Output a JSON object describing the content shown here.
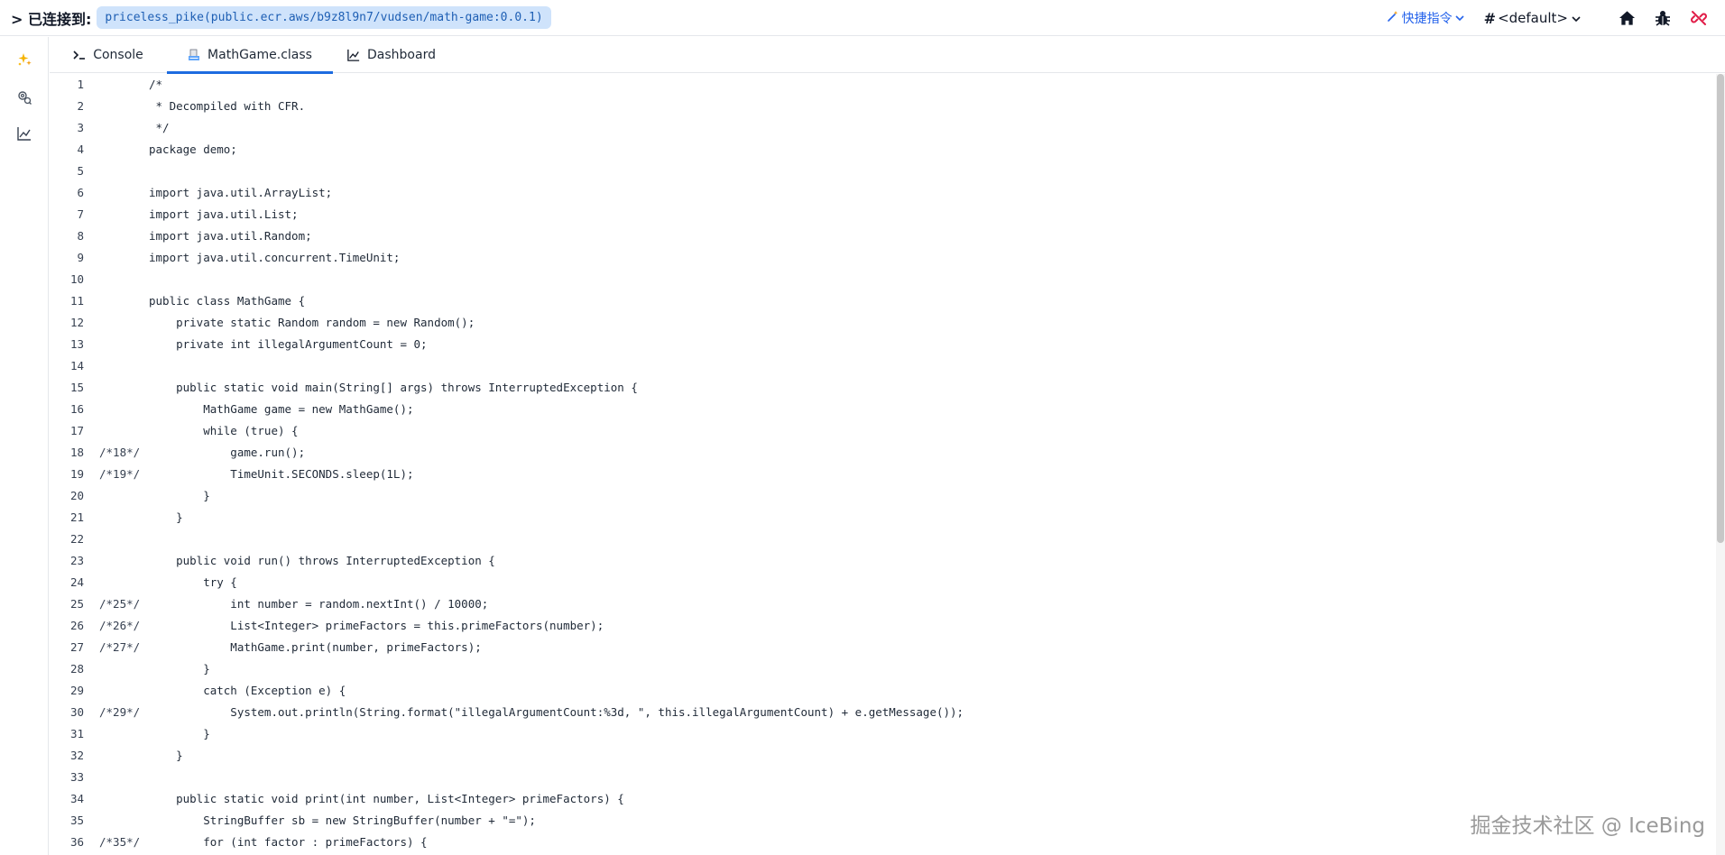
{
  "header": {
    "connected_label": "> 已连接到:",
    "connection": "priceless_pike(public.ecr.aws/b9z8l9n7/vudsen/math-game:0.0.1)",
    "quick_command": "快捷指令",
    "namespace": "<default>",
    "icons": [
      "home-icon",
      "bug-icon",
      "unlink-icon"
    ],
    "accent_color": "#2563eb",
    "danger_color": "#e11d48"
  },
  "sidebar": {
    "icons": [
      "sparkle-icon",
      "settings-search-icon",
      "chart-line-icon"
    ]
  },
  "tabs": [
    {
      "label": "Console",
      "icon": "terminal-icon",
      "active": false
    },
    {
      "label": "MathGame.class",
      "icon": "class-file-icon",
      "active": true
    },
    {
      "label": "Dashboard",
      "icon": "chart-line-icon",
      "active": false
    }
  ],
  "code": {
    "lines": [
      {
        "n": "1",
        "src": "",
        "text": "/*"
      },
      {
        "n": "2",
        "src": "",
        "text": " * Decompiled with CFR."
      },
      {
        "n": "3",
        "src": "",
        "text": " */"
      },
      {
        "n": "4",
        "src": "",
        "text": "package demo;"
      },
      {
        "n": "5",
        "src": "",
        "text": ""
      },
      {
        "n": "6",
        "src": "",
        "text": "import java.util.ArrayList;"
      },
      {
        "n": "7",
        "src": "",
        "text": "import java.util.List;"
      },
      {
        "n": "8",
        "src": "",
        "text": "import java.util.Random;"
      },
      {
        "n": "9",
        "src": "",
        "text": "import java.util.concurrent.TimeUnit;"
      },
      {
        "n": "10",
        "src": "",
        "text": ""
      },
      {
        "n": "11",
        "src": "",
        "text": "public class MathGame {"
      },
      {
        "n": "12",
        "src": "",
        "text": "    private static Random random = new Random();"
      },
      {
        "n": "13",
        "src": "",
        "text": "    private int illegalArgumentCount = 0;"
      },
      {
        "n": "14",
        "src": "",
        "text": ""
      },
      {
        "n": "15",
        "src": "",
        "text": "    public static void main(String[] args) throws InterruptedException {"
      },
      {
        "n": "16",
        "src": "",
        "text": "        MathGame game = new MathGame();"
      },
      {
        "n": "17",
        "src": "",
        "text": "        while (true) {"
      },
      {
        "n": "18",
        "src": "/*18*/",
        "text": "            game.run();"
      },
      {
        "n": "19",
        "src": "/*19*/",
        "text": "            TimeUnit.SECONDS.sleep(1L);"
      },
      {
        "n": "20",
        "src": "",
        "text": "        }"
      },
      {
        "n": "21",
        "src": "",
        "text": "    }"
      },
      {
        "n": "22",
        "src": "",
        "text": ""
      },
      {
        "n": "23",
        "src": "",
        "text": "    public void run() throws InterruptedException {"
      },
      {
        "n": "24",
        "src": "",
        "text": "        try {"
      },
      {
        "n": "25",
        "src": "/*25*/",
        "text": "            int number = random.nextInt() / 10000;"
      },
      {
        "n": "26",
        "src": "/*26*/",
        "text": "            List<Integer> primeFactors = this.primeFactors(number);"
      },
      {
        "n": "27",
        "src": "/*27*/",
        "text": "            MathGame.print(number, primeFactors);"
      },
      {
        "n": "28",
        "src": "",
        "text": "        }"
      },
      {
        "n": "29",
        "src": "",
        "text": "        catch (Exception e) {"
      },
      {
        "n": "30",
        "src": "/*29*/",
        "text": "            System.out.println(String.format(\"illegalArgumentCount:%3d, \", this.illegalArgumentCount) + e.getMessage());"
      },
      {
        "n": "31",
        "src": "",
        "text": "        }"
      },
      {
        "n": "32",
        "src": "",
        "text": "    }"
      },
      {
        "n": "33",
        "src": "",
        "text": ""
      },
      {
        "n": "34",
        "src": "",
        "text": "    public static void print(int number, List<Integer> primeFactors) {"
      },
      {
        "n": "35",
        "src": "",
        "text": "        StringBuffer sb = new StringBuffer(number + \"=\");"
      },
      {
        "n": "36",
        "src": "/*35*/",
        "text": "        for (int factor : primeFactors) {"
      }
    ]
  },
  "watermark": "掘金技术社区 @ IceBing"
}
